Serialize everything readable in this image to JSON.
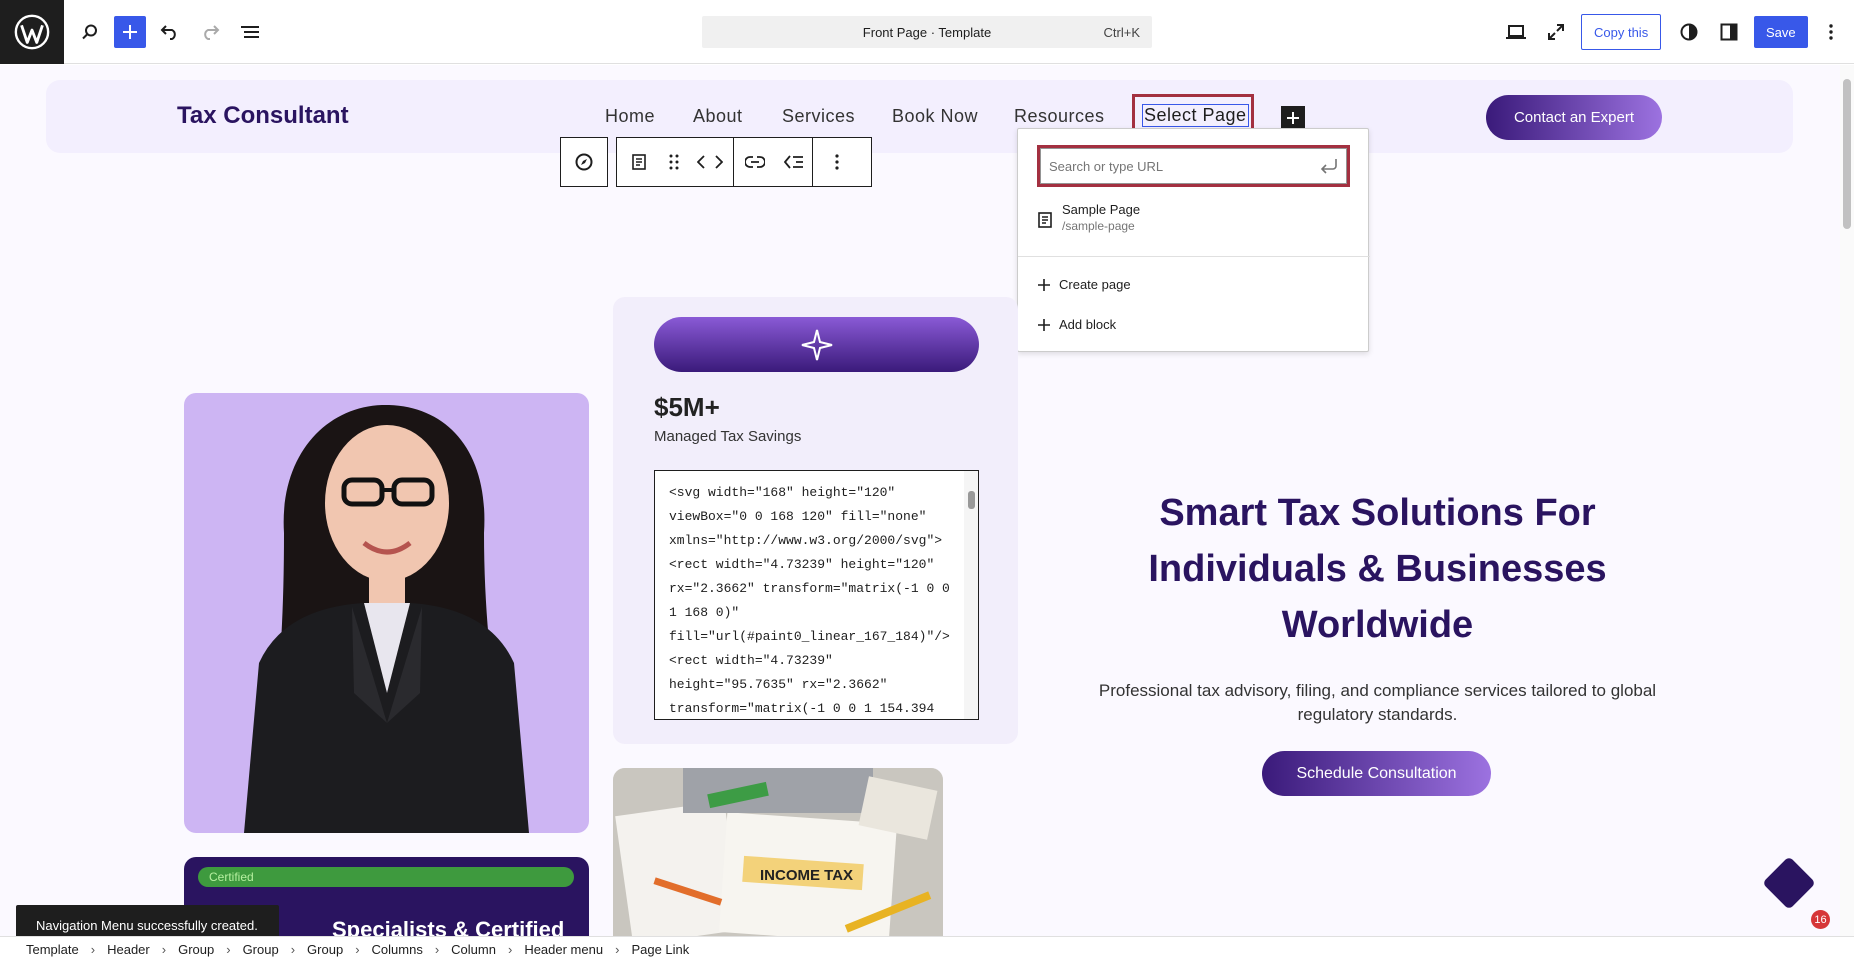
{
  "topbar": {
    "command_title": "Front Page · Template",
    "command_shortcut": "Ctrl+K",
    "copy_label": "Copy this",
    "save_label": "Save"
  },
  "site": {
    "title": "Tax Consultant",
    "nav": [
      "Home",
      "About",
      "Services",
      "Book Now",
      "Resources"
    ],
    "nav_selected": "Select Page",
    "contact_label": "Contact an Expert"
  },
  "link_popover": {
    "placeholder": "Search or type URL",
    "suggestion_title": "Sample Page",
    "suggestion_url": "/sample-page",
    "create_label": "Create page",
    "add_block_label": "Add block"
  },
  "stat": {
    "value": "$5M+",
    "label": "Managed Tax Savings",
    "code": "<svg width=\"168\" height=\"120\" viewBox=\"0 0 168 120\" fill=\"none\" xmlns=\"http://www.w3.org/2000/svg\">\n<rect width=\"4.73239\" height=\"120\" rx=\"2.3662\" transform=\"matrix(-1 0 0 1 168 0)\" fill=\"url(#paint0_linear_167_184)\"/>\n<rect width=\"4.73239\" height=\"95.7635\" rx=\"2.3662\" transform=\"matrix(-1 0 0 1 154.394"
  },
  "cert": {
    "badge": "Certified",
    "title": "Specialists & Certified"
  },
  "tax_image_text": "INCOME TAX",
  "hero": {
    "heading": "Smart Tax Solutions For Individuals & Businesses Worldwide",
    "subtitle": "Professional tax advisory, filing, and compliance services tailored to global regulatory standards.",
    "button": "Schedule Consultation"
  },
  "notification_count": "16",
  "snackbar": "Navigation Menu successfully created.",
  "breadcrumbs": [
    "Template",
    "Header",
    "Group",
    "Group",
    "Group",
    "Columns",
    "Column",
    "Header menu",
    "Page Link"
  ],
  "colors": {
    "accent": "#3858e9",
    "brand_dark": "#2a1460",
    "highlight_border": "#a33040"
  }
}
